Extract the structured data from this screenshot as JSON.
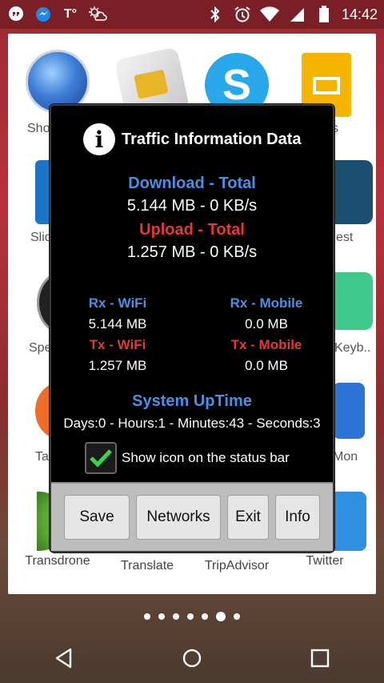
{
  "status_bar": {
    "time": "14:42",
    "left_icons": [
      "hangouts-icon",
      "messenger-icon",
      "tumblr-icon",
      "weather-icon"
    ],
    "right_icons": [
      "bluetooth-icon",
      "alarm-icon",
      "wifi-icon",
      "signal-icon",
      "battery-icon"
    ]
  },
  "apps": {
    "row1": [
      {
        "label": "Sho",
        "icon": "globe-icon"
      },
      {
        "label": "",
        "icon": "sim-card-icon"
      },
      {
        "label": "",
        "icon": "skype-icon"
      },
      {
        "label": "s",
        "icon": "slides-icon"
      }
    ],
    "row2": [
      {
        "label": "Slid",
        "icon": "slide-icon"
      },
      {
        "label": "est",
        "icon": "speedtest-icon"
      }
    ],
    "row3": [
      {
        "label": "Spe",
        "icon": "speedometer-icon"
      },
      {
        "label": "Keyb..",
        "icon": "keyboard-icon"
      }
    ],
    "row4": [
      {
        "label": "Ta",
        "icon": "chat-bubble-icon"
      },
      {
        "label": "Mon",
        "icon": "monitor-icon"
      }
    ],
    "row5": [
      {
        "label": "Transdrone",
        "icon": "transdrone-icon"
      },
      {
        "label": "Translate",
        "icon": "translate-icon"
      },
      {
        "label": "TripAdvisor",
        "icon": "tripadvisor-icon"
      },
      {
        "label": "Twitter",
        "icon": "twitter-icon"
      }
    ]
  },
  "dialog": {
    "title": "Traffic Information Data",
    "download_header": "Download - Total",
    "download_value": "5.144 MB - 0 KB/s",
    "upload_header": "Upload - Total",
    "upload_value": "1.257 MB - 0 KB/s",
    "rx_wifi_label": "Rx - WiFi",
    "rx_mobile_label": "Rx - Mobile",
    "rx_wifi_value": "5.144 MB",
    "rx_mobile_value": "0.0 MB",
    "tx_wifi_label": "Tx - WiFi",
    "tx_mobile_label": "Tx - Mobile",
    "tx_wifi_value": "1.257 MB",
    "tx_mobile_value": "0.0 MB",
    "uptime_header": "System UpTime",
    "uptime_value": "Days:0 - Hours:1 - Minutes:43 - Seconds:3",
    "checkbox_label": "Show icon on the status bar",
    "checkbox_checked": true,
    "buttons": {
      "save": "Save",
      "networks": "Networks",
      "exit": "Exit",
      "info": "Info"
    }
  },
  "pager": {
    "count": 7,
    "active_index": 5
  },
  "colors": {
    "blue_label": "#4a90e2",
    "red_label": "#e53935",
    "checkmark": "#3bd54a"
  }
}
